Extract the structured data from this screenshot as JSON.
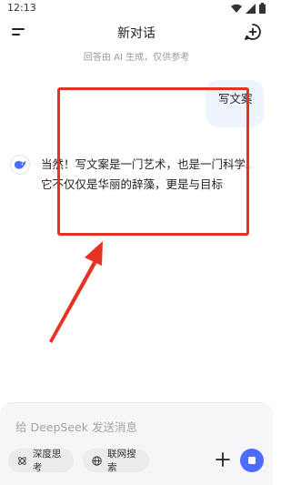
{
  "status_bar": {
    "time": "12:13",
    "icons": [
      "wifi-icon",
      "signal-icon",
      "battery-icon"
    ]
  },
  "header": {
    "title": "新对话",
    "menu_icon": "menu-icon",
    "new_chat_icon": "new-chat-icon"
  },
  "disclaimer": "回答由 AI 生成，仅供参考",
  "conversation": {
    "user_message": "写文案",
    "bot_message": "当然！写文案是一门艺术，也是一门科学。它不仅仅是华丽的辞藻，更是与目标"
  },
  "annotation": {
    "highlight_color": "#e53223"
  },
  "composer": {
    "placeholder": "给 DeepSeek 发送消息",
    "deep_think_label": "深度思考",
    "web_search_label": "联网搜索",
    "send_color": "#4d6bfe"
  }
}
